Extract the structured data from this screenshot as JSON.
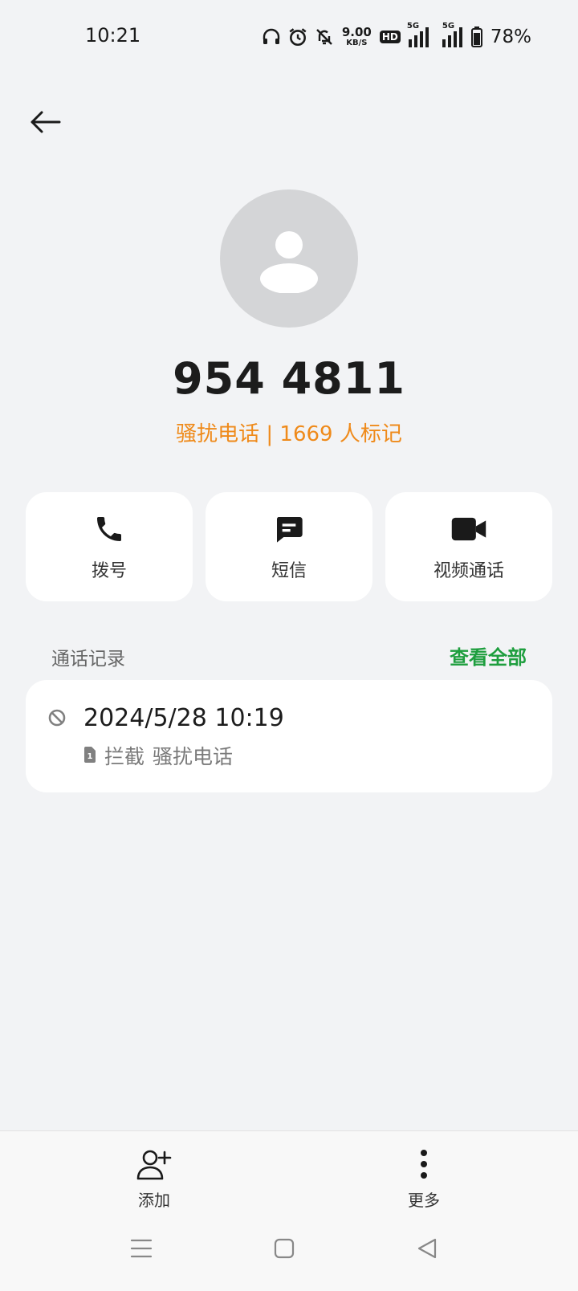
{
  "status_bar": {
    "time": "10:21",
    "net_speed_value": "9.00",
    "net_speed_unit": "KB/S",
    "hd_label": "HD",
    "sim1_network": "5G",
    "sim2_network": "5G",
    "battery_percent": "78%"
  },
  "contact": {
    "number": "954 4811",
    "spam_label": "骚扰电话 | 1669 人标记"
  },
  "actions": [
    {
      "label": "拨号",
      "icon": "phone-icon"
    },
    {
      "label": "短信",
      "icon": "message-icon"
    },
    {
      "label": "视频通话",
      "icon": "video-camera-icon"
    }
  ],
  "call_log": {
    "title": "通话记录",
    "view_all": "查看全部",
    "entries": [
      {
        "time": "2024/5/28 10:19",
        "status": "拦截",
        "type": "骚扰电话",
        "sim": "1",
        "icon": "blocked-icon"
      }
    ]
  },
  "bottom_bar": {
    "add_label": "添加",
    "more_label": "更多"
  },
  "colors": {
    "accent_green": "#1e9e3e",
    "spam_orange": "#ef8a1a",
    "background": "#f2f3f5"
  }
}
